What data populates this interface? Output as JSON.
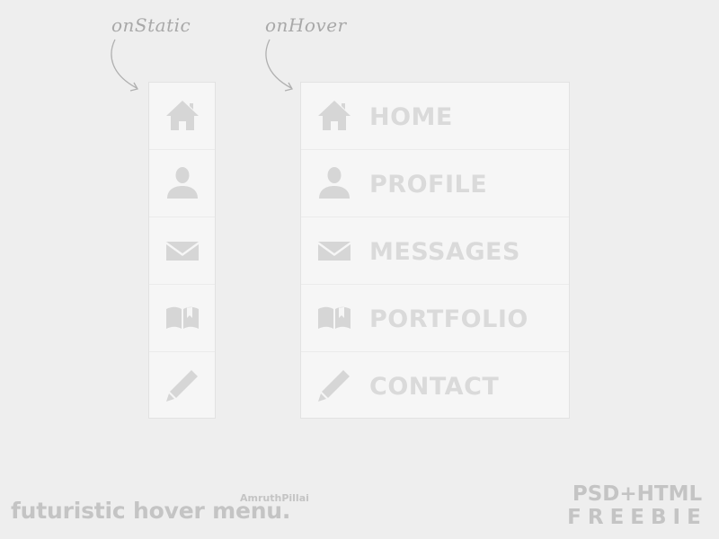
{
  "annotations": {
    "static_label": "onStatic",
    "hover_label": "onHover"
  },
  "menu_static": {
    "items": [
      {
        "icon": "home-icon"
      },
      {
        "icon": "user-icon"
      },
      {
        "icon": "mail-icon"
      },
      {
        "icon": "book-icon"
      },
      {
        "icon": "pencil-icon"
      }
    ]
  },
  "menu_hover": {
    "items": [
      {
        "icon": "home-icon",
        "label": "HOME"
      },
      {
        "icon": "user-icon",
        "label": "PROFILE"
      },
      {
        "icon": "mail-icon",
        "label": "MESSAGES"
      },
      {
        "icon": "book-icon",
        "label": "PORTFOLIO"
      },
      {
        "icon": "pencil-icon",
        "label": "CONTACT"
      }
    ]
  },
  "footer": {
    "title": "futuristic hover menu.",
    "author": "AmruthPillai",
    "badge_top": "PSD+HTML",
    "badge_bottom": "FREEBIE"
  },
  "colors": {
    "background": "#eeeeee",
    "menu_bg": "#f6f6f6",
    "icon": "#d6d6d6",
    "label": "#dadada",
    "footer_text": "#c4c4c4",
    "annotation": "#a8a8a8"
  }
}
